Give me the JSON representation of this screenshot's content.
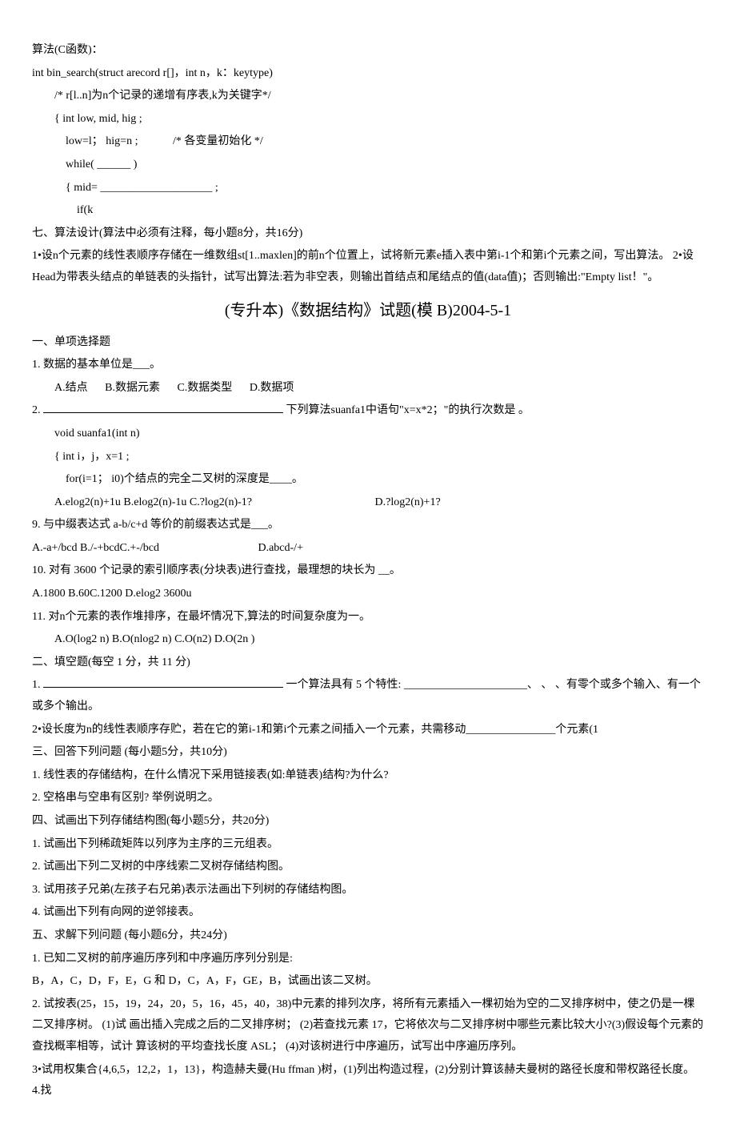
{
  "top": {
    "l1": "算法(C函数)：",
    "l2": "int bin_search(struct arecord r[]，int n，k：keytype)",
    "l3": "/* r[l..n]为n个记录的递增有序表,k为关键字*/",
    "l4": "{ int low, mid, hig ;",
    "l5_a": "low=l；  hig=n ;",
    "l5_b": "/* 各变量初始化  */",
    "l6": "while( ______ )",
    "l7": "{ mid= ____________________ ;",
    "l8": "if(k"
  },
  "sec7": {
    "title": "七、算法设计(算法中必须有注释，每小题8分，共16分)",
    "q1": "1•设n个元素的线性表顺序存储在一维数组st[1..maxlen]的前n个位置上，试将新元素e插入表中第i-1个和第i个元素之间，写出算法。  2•设Head为带表头结点的单链表的头指针，试写出算法:若为非空表，则输出首结点和尾结点的值(data值)；否则输出:\"Empty list！\"。"
  },
  "paperTitle": "(专升本)《数据结构》试题(模  B)2004-5-1",
  "sec1": {
    "title": "一、单项选择题",
    "q1": "1.  数据的基本单位是___。",
    "q1opts": {
      "a": "A.结点",
      "b": "B.数据元素",
      "c": "C.数据类型",
      "d": "D.数据项"
    },
    "q2a": "2.",
    "q2b": "下列算法suanfa1中语句\"x=x*2；\"的执行次数是     。",
    "q2c1": "void suanfa1(int n)",
    "q2c2": "{ int i，j，x=1 ;",
    "q2c3": "for(i=1；  i0)个结点的完全二叉树的深度是____。",
    "q2opts": {
      "a_c": "A.elog2(n)+1u B.elog2(n)-1u C.?log2(n)-1?",
      "d": "D.?log2(n)+1?"
    },
    "q9": "9.  与中缀表达式  a-b/c+d 等价的前缀表达式是___。",
    "q9opts": {
      "a_c": "A.-a+/bcd B./-+bcdC.+-/bcd",
      "d": "D.abcd-/+"
    },
    "q10": "10.  对有  3600 个记录的索引顺序表(分块表)进行查找，最理想的块长为 __。",
    "q10opts": "A.1800            B.60C.1200 D.elog2 3600u",
    "q11": "11.  对n个元素的表作堆排序，在最坏情况下,算法的时间复杂度为一。",
    "q11opts": "A.O(log2 n) B.O(nlog2 n) C.O(n2) D.O(2n )"
  },
  "sec2": {
    "title": "二、填空题(每空  1 分，共  11 分)",
    "q1a": "1.",
    "q1b": "一个算法具有  5 个特性: ______________________、      、    、有零个或多个输入、有一个或多个输出。",
    "q2": "2•设长度为n的线性表顺序存贮，若在它的第i-1和第i个元素之间插入一个元素，共需移动________________个元素(1"
  },
  "sec3": {
    "title": "三、回答下列问题  (每小题5分，共10分)",
    "q1": "1.  线性表的存储结构，在什么情况下采用链接表(如:单链表)结构?为什么?",
    "q2": "2.  空格串与空串有区别?  举例说明之。"
  },
  "sec4": {
    "title": "四、试画出下列存储结构图(每小题5分，共20分)",
    "q1": "1.  试画出下列稀疏矩阵以列序为主序的三元组表。",
    "q2": "2.  试画出下列二叉树的中序线索二叉树存储结构图。",
    "q3": "3.  试用孩子兄弟(左孩子右兄弟)表示法画出下列树的存储结构图。",
    "q4": "4.  试画出下列有向网的逆邻接表。"
  },
  "sec5": {
    "title": "五、求解下列问题  (每小题6分，共24分)",
    "q1a": "1.  已知二叉树的前序遍历序列和中序遍历序列分别是:",
    "q1b": "B，A，C，D，F，E，G 和 D，C，A，F，GE，B，试画出该二叉树。",
    "q2": "2.  试按表(25，15，19，24，20，5，16，45，40，38)中元素的排列次序，将所有元素插入一棵初始为空的二叉排序树中，使之仍是一棵二叉排序树。  (1)试  画出插入完成之后的二叉排序树；  (2)若查找元素  17，它将依次与二叉排序树中哪些元素比较大小?(3)假设每个元素的查找概率相等，试计  算该树的平均查找长度  ASL；  (4)对该树进行中序遍历，试写出中序遍历序列。",
    "q3": "3•试用权集合{4,6,5，12,2，1，13}，构造赫夫曼(Hu ffman )树，(1)列出构造过程，(2)分别计算该赫夫曼树的路径长度和带权路径长度。  4.找"
  }
}
